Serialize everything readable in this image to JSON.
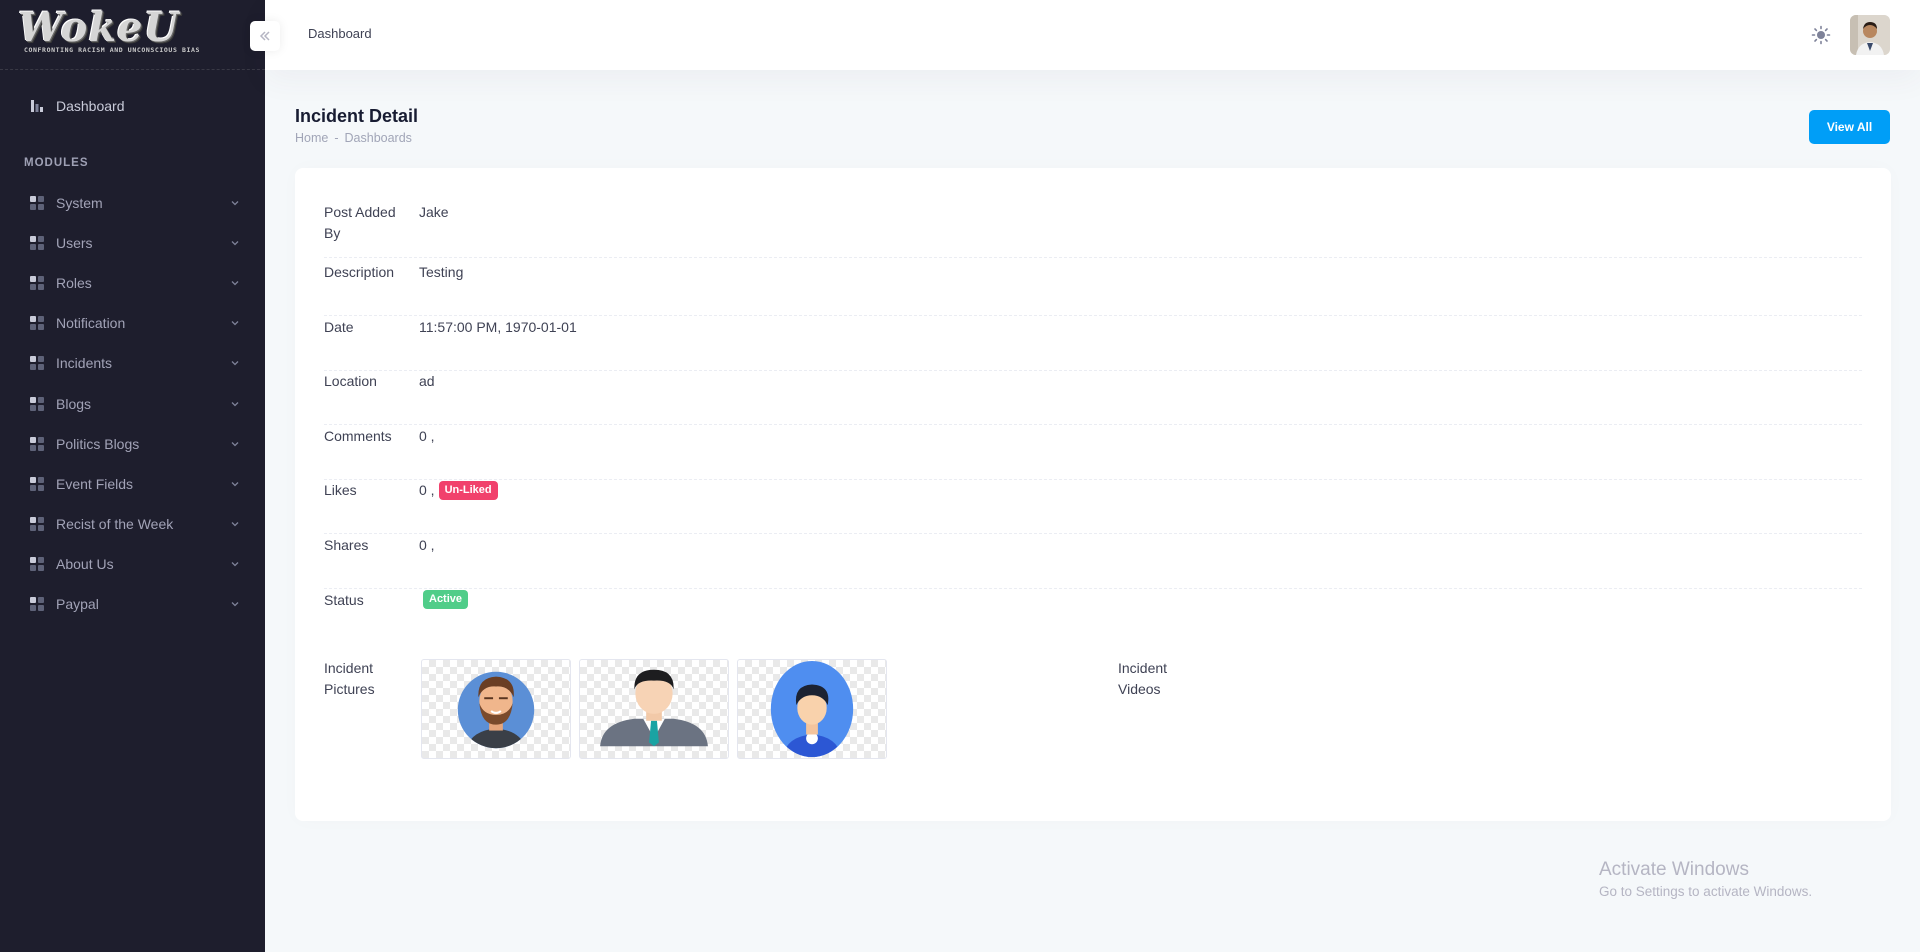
{
  "brand": {
    "logo_text": "WokeU",
    "tagline": "CONFRONTING RACISM AND UNCONSCIOUS BIAS"
  },
  "header": {
    "title": "Dashboard"
  },
  "sidebar": {
    "dashboard_label": "Dashboard",
    "section_label": "MODULES",
    "items": [
      {
        "label": "System"
      },
      {
        "label": "Users"
      },
      {
        "label": "Roles"
      },
      {
        "label": "Notification"
      },
      {
        "label": "Incidents"
      },
      {
        "label": "Blogs"
      },
      {
        "label": "Politics Blogs"
      },
      {
        "label": "Event Fields"
      },
      {
        "label": "Recist of the Week"
      },
      {
        "label": "About Us"
      },
      {
        "label": "Paypal"
      }
    ]
  },
  "toolbar": {
    "title": "Incident Detail",
    "breadcrumb": [
      "Home",
      "-",
      "Dashboards"
    ],
    "view_all_label": "View All"
  },
  "detail": {
    "rows": [
      {
        "key": "Post Added By",
        "value": "Jake"
      },
      {
        "key": "Description",
        "value": "Testing"
      },
      {
        "key": "Date",
        "value": "11:57:00 PM, 1970-01-01"
      },
      {
        "key": "Location",
        "value": "ad"
      },
      {
        "key": "Comments",
        "value": "0 ,"
      },
      {
        "key": "Likes",
        "value": "0 ,",
        "badge": "Un-Liked"
      },
      {
        "key": "Shares",
        "value": "0 ,"
      },
      {
        "key": "Status",
        "value": "",
        "badge": "Active"
      }
    ],
    "pictures_label": "Incident Pictures",
    "videos_label": "Incident Videos",
    "pictures": [
      {
        "icon": "bearded-man-avatar"
      },
      {
        "icon": "businessman-avatar"
      },
      {
        "icon": "boy-avatar"
      }
    ]
  },
  "watermark": {
    "line1": "Activate Windows",
    "line2": "Go to Settings to activate Windows."
  },
  "colors": {
    "sidebar_bg": "#1e1e2d",
    "primary": "#009ef7",
    "danger": "#f1416c",
    "success": "#50cd89",
    "page_bg": "#f5f8fa"
  }
}
